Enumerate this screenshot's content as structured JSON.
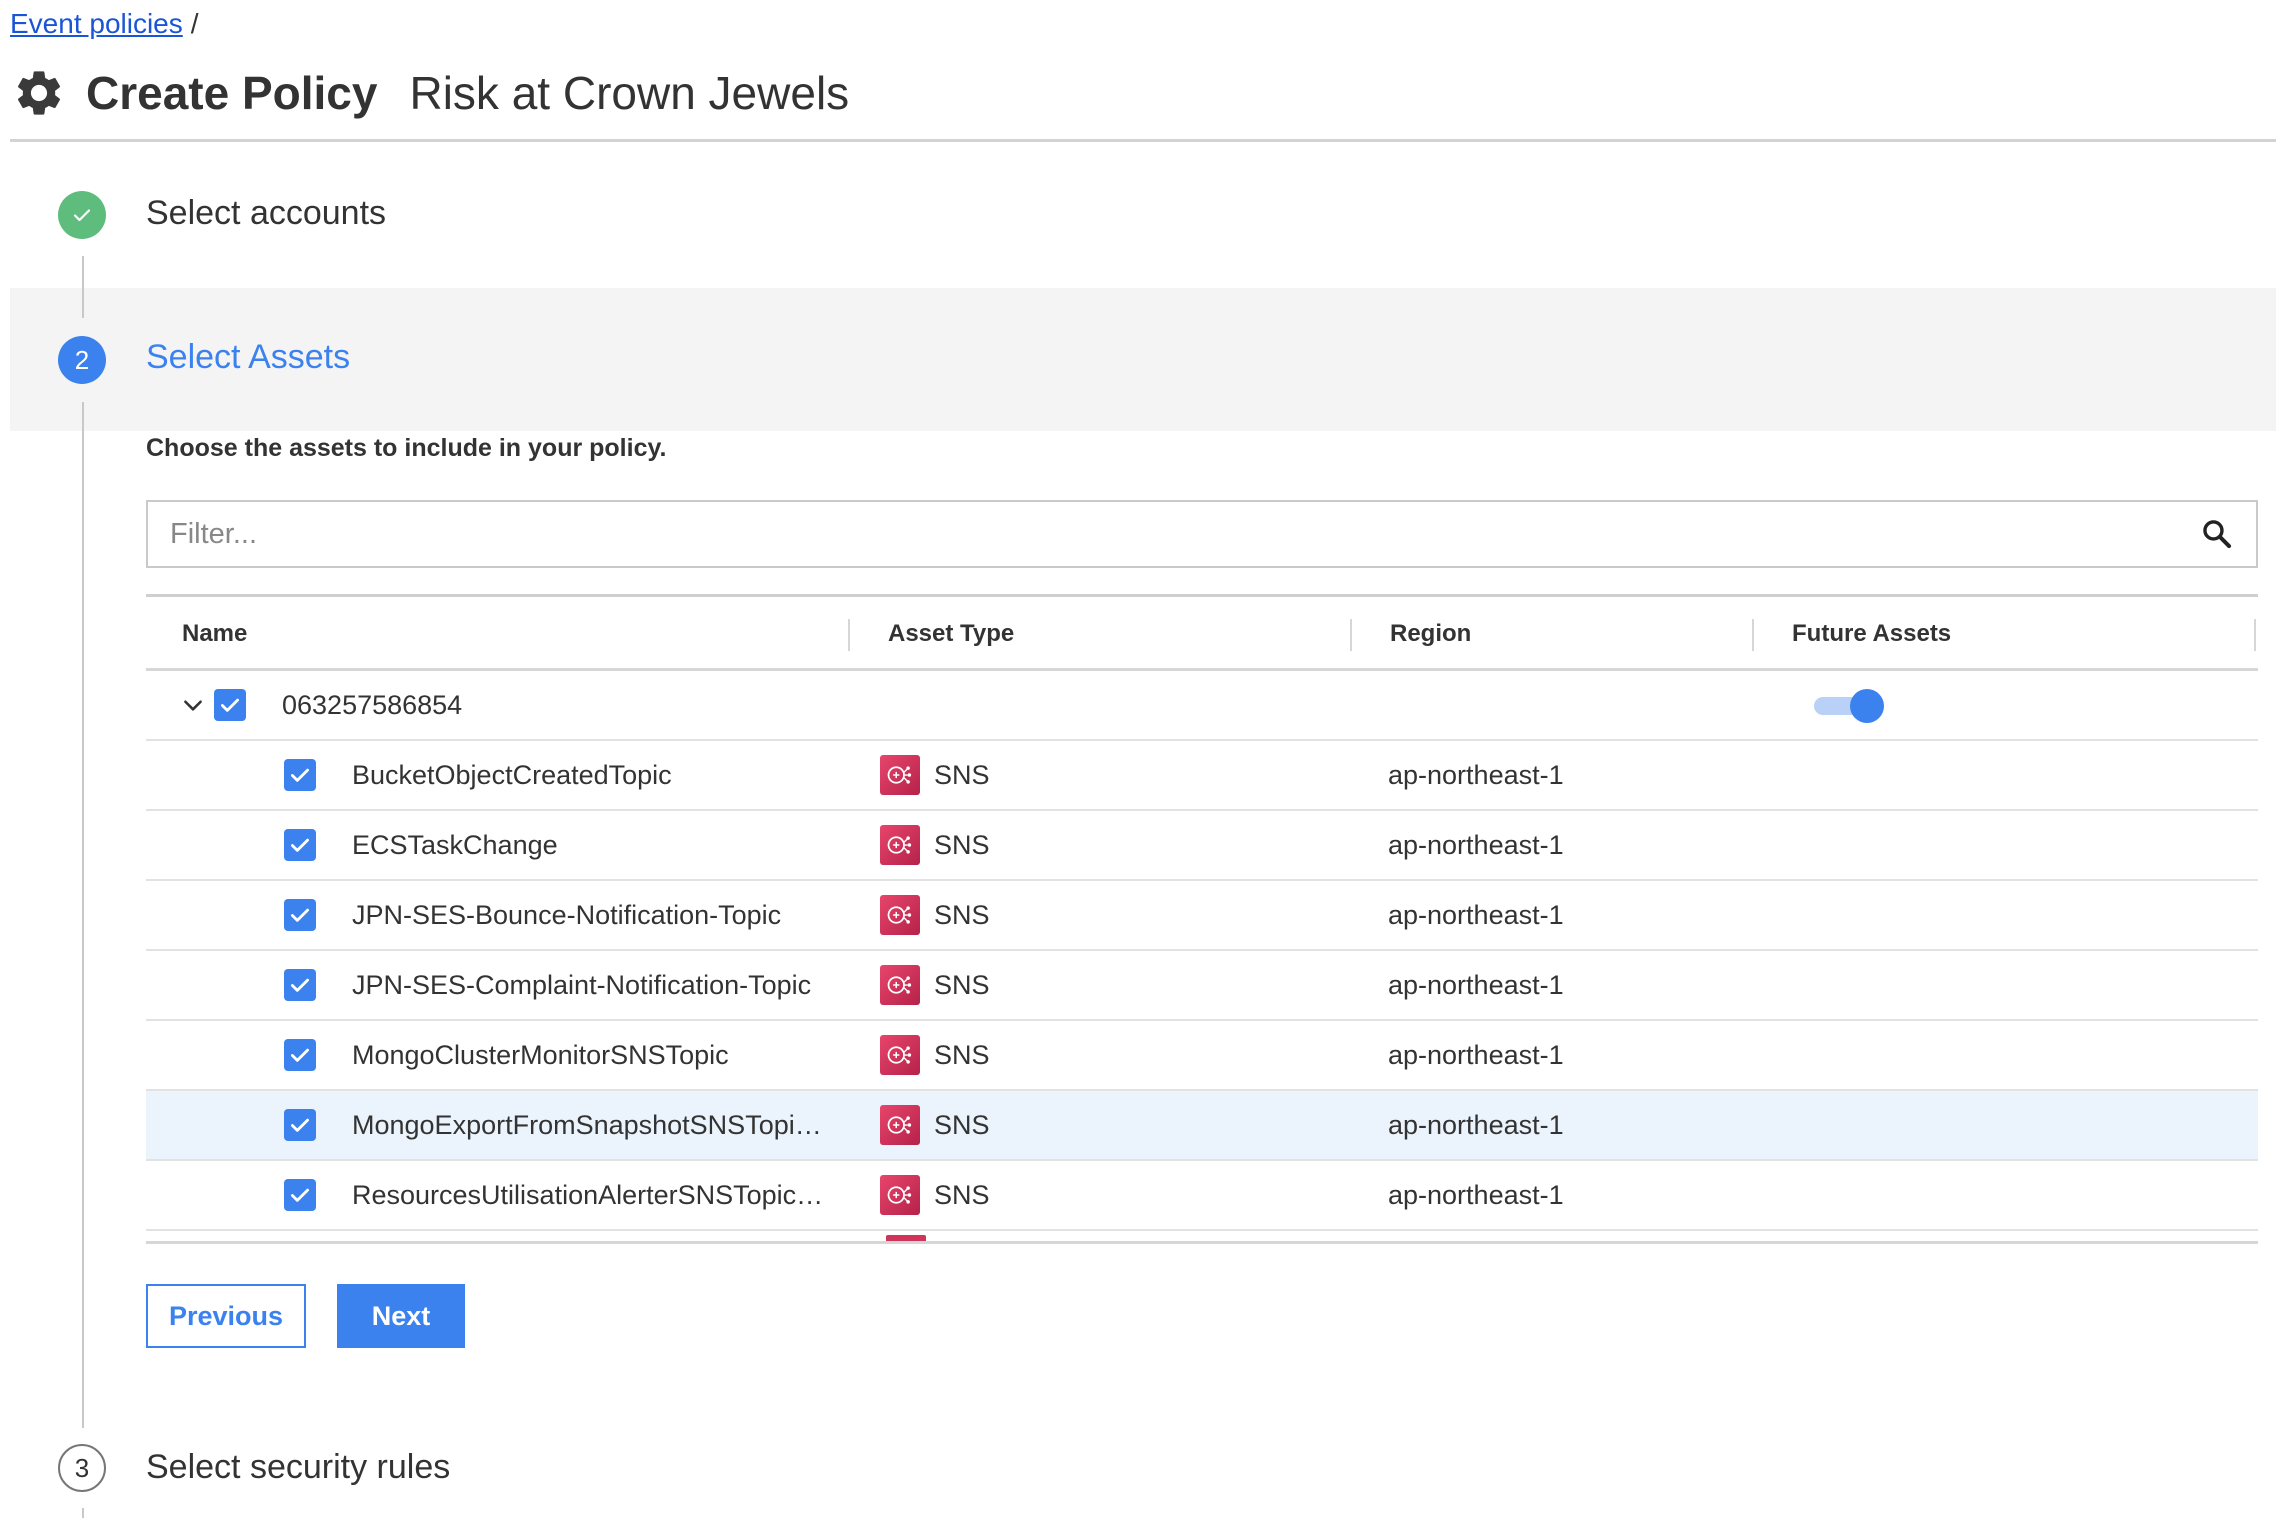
{
  "breadcrumb": {
    "link": "Event policies",
    "separator": "/"
  },
  "header": {
    "title": "Create Policy",
    "subtitle": "Risk at Crown Jewels",
    "icon": "gear-icon"
  },
  "steps": [
    {
      "number": "1",
      "label": "Select accounts",
      "status": "done"
    },
    {
      "number": "2",
      "label": "Select Assets",
      "status": "active"
    },
    {
      "number": "3",
      "label": "Select security rules",
      "status": "pending"
    }
  ],
  "assets": {
    "description": "Choose the assets to include in your policy.",
    "filter_placeholder": "Filter...",
    "columns": [
      "Name",
      "Asset Type",
      "Region",
      "Future Assets"
    ],
    "account": {
      "id": "063257586854",
      "checked": true,
      "expanded": true,
      "future_assets": true
    },
    "rows": [
      {
        "name": "BucketObjectCreatedTopic",
        "type": "SNS",
        "region": "ap-northeast-1",
        "checked": true
      },
      {
        "name": "ECSTaskChange",
        "type": "SNS",
        "region": "ap-northeast-1",
        "checked": true
      },
      {
        "name": "JPN-SES-Bounce-Notification-Topic",
        "type": "SNS",
        "region": "ap-northeast-1",
        "checked": true
      },
      {
        "name": "JPN-SES-Complaint-Notification-Topic",
        "type": "SNS",
        "region": "ap-northeast-1",
        "checked": true
      },
      {
        "name": "MongoClusterMonitorSNSTopic",
        "type": "SNS",
        "region": "ap-northeast-1",
        "checked": true
      },
      {
        "name": "MongoExportFromSnapshotSNSTopi…",
        "type": "SNS",
        "region": "ap-northeast-1",
        "checked": true,
        "highlighted": true
      },
      {
        "name": "ResourcesUtilisationAlerterSNSTopic…",
        "type": "SNS",
        "region": "ap-northeast-1",
        "checked": true
      }
    ]
  },
  "buttons": {
    "previous": "Previous",
    "next": "Next"
  },
  "colors": {
    "primary": "#3b82ef",
    "success": "#5ebd7d",
    "sns": "#d1345b",
    "highlight": "#ebf3fc"
  }
}
